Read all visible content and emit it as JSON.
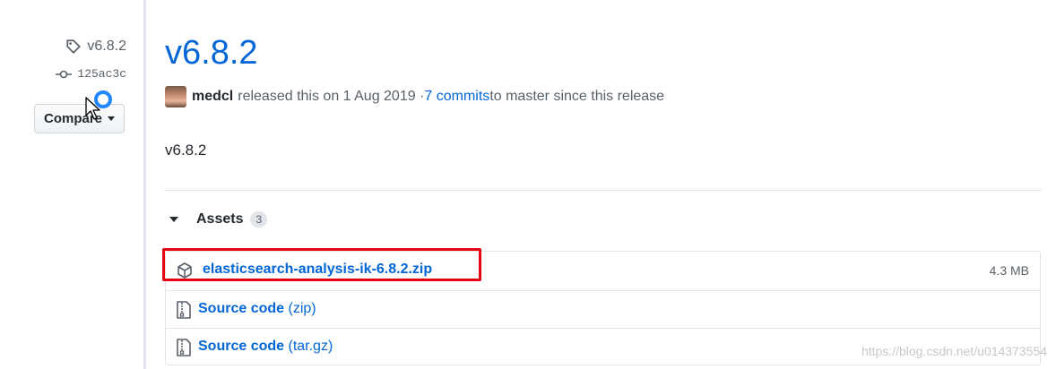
{
  "sidebar": {
    "tag": "v6.8.2",
    "commit": "125ac3c",
    "compare_label": "Compare"
  },
  "release": {
    "title": "v6.8.2",
    "author": "medcl",
    "released_text": "released this on 1 Aug 2019 · ",
    "commits_link": "7 commits",
    "commits_suffix": " to master since this release",
    "body": "v6.8.2"
  },
  "assets": {
    "label": "Assets",
    "count": "3",
    "items": [
      {
        "name": "elasticsearch-analysis-ik-6.8.2.zip",
        "size": "4.3 MB"
      },
      {
        "name": "Source code",
        "suffix": "(zip)"
      },
      {
        "name": "Source code",
        "suffix": "(tar.gz)"
      }
    ]
  },
  "watermark": "https://blog.csdn.net/u014373554",
  "colors": {
    "link": "#0366d6",
    "highlight": "#e60012",
    "spinner": "#2188ff"
  }
}
